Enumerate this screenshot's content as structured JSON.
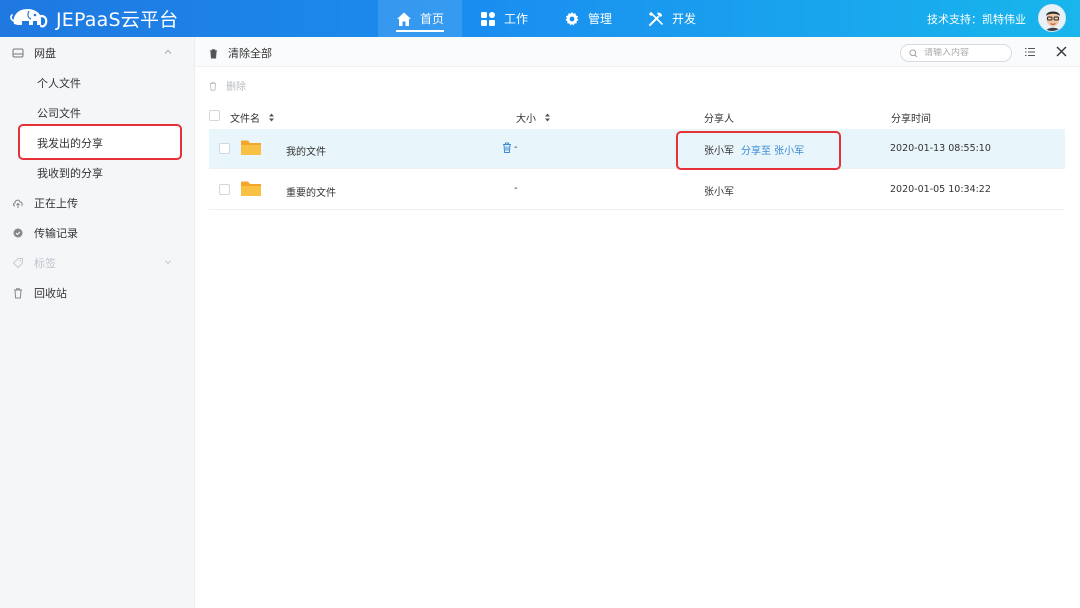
{
  "app": {
    "name": "JEPaaS云平台"
  },
  "nav": [
    {
      "label": "首页",
      "icon": "home-icon",
      "active": true
    },
    {
      "label": "工作",
      "icon": "grid-icon",
      "active": false
    },
    {
      "label": "管理",
      "icon": "gear-icon",
      "active": false
    },
    {
      "label": "开发",
      "icon": "tools-icon",
      "active": false
    }
  ],
  "header": {
    "support": "技术支持：凯特伟业"
  },
  "sidebar": {
    "items": [
      {
        "label": "网盘",
        "icon": "disk-icon"
      },
      {
        "label": "个人文件"
      },
      {
        "label": "公司文件"
      },
      {
        "label": "我发出的分享",
        "selected": true
      },
      {
        "label": "我收到的分享"
      },
      {
        "label": "正在上传",
        "icon": "upload-cloud-icon"
      },
      {
        "label": "传输记录",
        "icon": "check-circle-icon"
      },
      {
        "label": "标签",
        "icon": "tag-icon",
        "disabled": true
      },
      {
        "label": "回收站",
        "icon": "trash-icon"
      }
    ]
  },
  "toolbar": {
    "clear_all": "清除全部",
    "search_placeholder": "请输入内容",
    "delete": "删除"
  },
  "table": {
    "columns": {
      "name": "文件名",
      "size": "大小",
      "sharer": "分享人",
      "time": "分享时间"
    },
    "rows": [
      {
        "name": "我的文件",
        "size": "-",
        "sharer": "张小军",
        "share_to": "分享至 张小军",
        "time": "2020-01-13 08:55:10",
        "selected": true
      },
      {
        "name": "重要的文件",
        "size": "-",
        "sharer": "张小军",
        "share_to": "",
        "time": "2020-01-05 10:34:22",
        "selected": false
      }
    ]
  },
  "colors": {
    "header_start": "#1f78e0",
    "header_end": "#18b6ec",
    "highlight": "#e53238",
    "link": "#3c8ad6",
    "folder": "#f7b733"
  }
}
